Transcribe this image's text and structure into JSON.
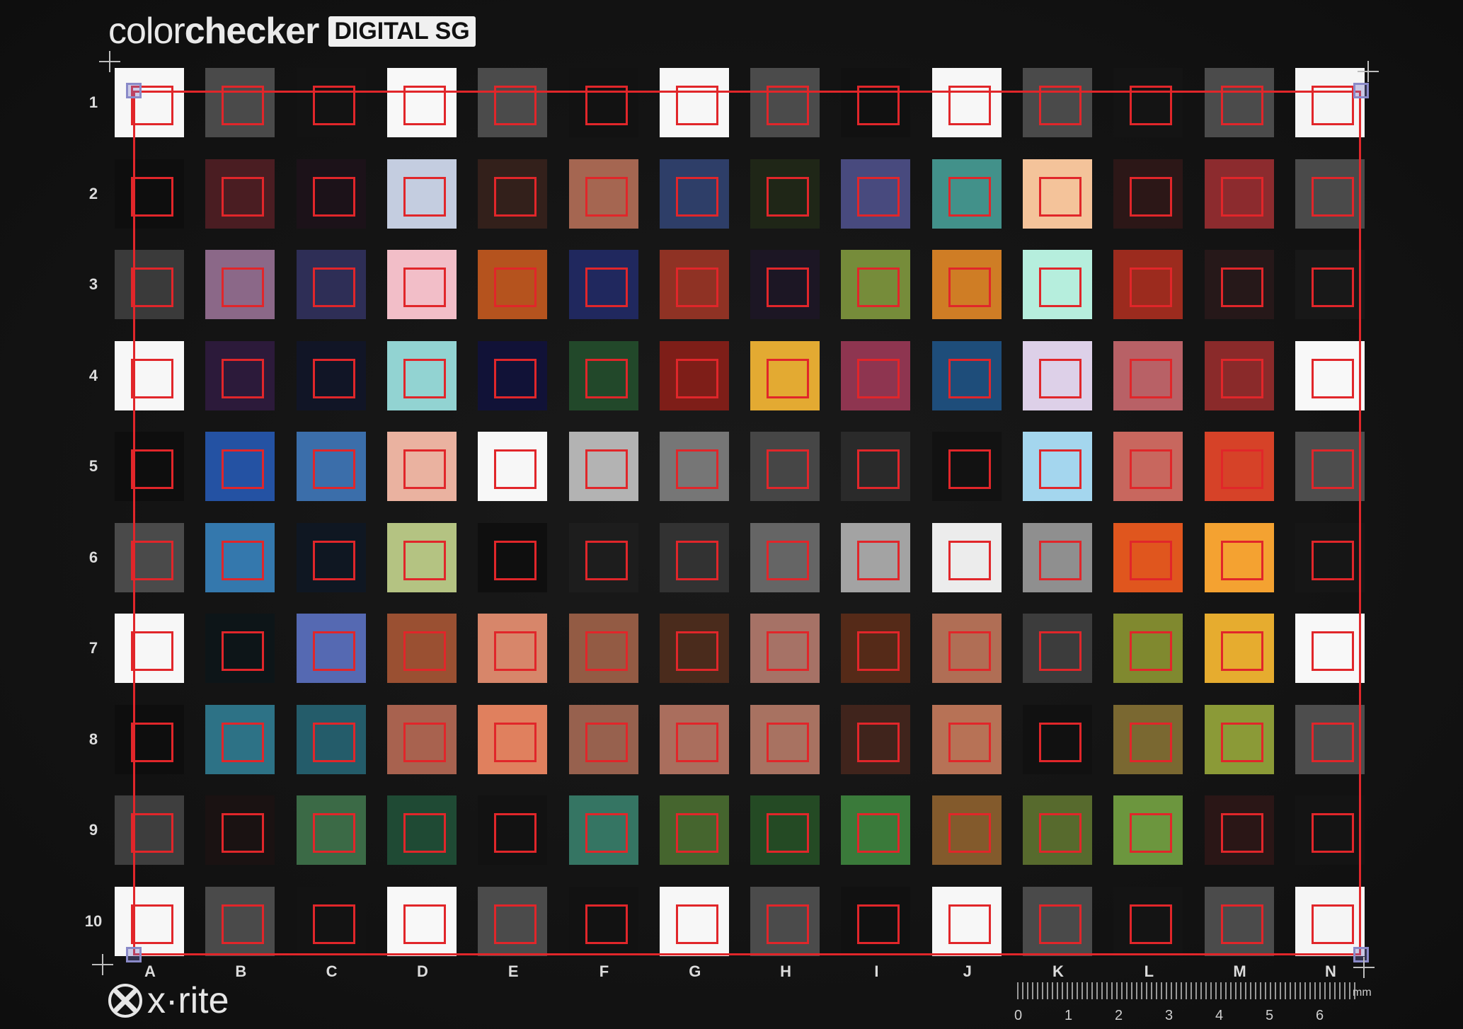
{
  "logo": {
    "light": "color",
    "bold": "checker",
    "badge": "DIGITAL SG"
  },
  "brand": {
    "name": "x·rite",
    "icon": "xrite-logo-icon"
  },
  "columns": [
    "A",
    "B",
    "C",
    "D",
    "E",
    "F",
    "G",
    "H",
    "I",
    "J",
    "K",
    "L",
    "M",
    "N"
  ],
  "rows": [
    "1",
    "2",
    "3",
    "4",
    "5",
    "6",
    "7",
    "8",
    "9",
    "10"
  ],
  "ruler": {
    "numbers": [
      "0",
      "1",
      "2",
      "3",
      "4",
      "5",
      "6"
    ],
    "unit": "mm"
  },
  "colors": {
    "marker": "#e1262a",
    "background": "#141414"
  },
  "patches": [
    [
      "#f7f7f7",
      "#4a4a4a",
      "#131313",
      "#f8f8f8",
      "#4b4b4b",
      "#121212",
      "#f7f7f7",
      "#4b4b4b",
      "#111111",
      "#f7f7f7",
      "#4a4a4a",
      "#141414",
      "#4b4b4b",
      "#f5f5f5"
    ],
    [
      "#0e0e0e",
      "#4a1d22",
      "#1c1219",
      "#c4cde0",
      "#33201b",
      "#a56651",
      "#2e3e68",
      "#1f2617",
      "#484a7e",
      "#42918a",
      "#f4c39a",
      "#2c1717",
      "#8c2b2e",
      "#4a4a4a"
    ],
    [
      "#3a3a3a",
      "#8b6888",
      "#2e2e56",
      "#f2bec8",
      "#b5531e",
      "#20285e",
      "#8f3224",
      "#1c1624",
      "#768c3a",
      "#cf7d25",
      "#b6eedd",
      "#9c2b1e",
      "#261819",
      "#181818"
    ],
    [
      "#f7f7f7",
      "#2c1a3a",
      "#111526",
      "#92d3d2",
      "#111237",
      "#22482a",
      "#7e1e18",
      "#e3aa32",
      "#8e3550",
      "#1e4d7a",
      "#ddd0e8",
      "#b86166",
      "#8a2a2a",
      "#f8f8f8"
    ],
    [
      "#0e0e0e",
      "#2452a3",
      "#3b6eaa",
      "#eab2a0",
      "#f7f7f7",
      "#b3b3b3",
      "#767676",
      "#464646",
      "#2a2a2a",
      "#121212",
      "#a4d6ee",
      "#c8675e",
      "#d64228",
      "#4d4d4d"
    ],
    [
      "#4a4a4a",
      "#3478ad",
      "#0f1722",
      "#b4c382",
      "#0f0f0f",
      "#1d1d1d",
      "#323232",
      "#656565",
      "#a3a3a3",
      "#ececec",
      "#8f8f8f",
      "#e0561e",
      "#f4a231",
      "#161616"
    ],
    [
      "#f7f7f7",
      "#0d1518",
      "#5569b2",
      "#9a5032",
      "#d7866a",
      "#935b44",
      "#4a2b1c",
      "#a67266",
      "#552a18",
      "#b06e55",
      "#3c3c3c",
      "#80892f",
      "#e6ac2f",
      "#f8f8f8"
    ],
    [
      "#0e0e0e",
      "#2d7286",
      "#245c6a",
      "#a8624f",
      "#e0805e",
      "#97614e",
      "#aa6e5d",
      "#a87261",
      "#40241c",
      "#b77256",
      "#111111",
      "#7a6831",
      "#8b9a37",
      "#4d4d4d"
    ],
    [
      "#3e3e3e",
      "#1a1212",
      "#3b6a46",
      "#1f4a34",
      "#121212",
      "#357563",
      "#45652e",
      "#244a24",
      "#3a7a3a",
      "#835a2c",
      "#576a2d",
      "#6c963e",
      "#2a1616",
      "#141414"
    ],
    [
      "#f7f7f7",
      "#4a4a4a",
      "#131313",
      "#f8f8f8",
      "#4b4b4b",
      "#121212",
      "#f7f7f7",
      "#4b4b4b",
      "#111111",
      "#f7f7f7",
      "#4a4a4a",
      "#141414",
      "#4b4b4b",
      "#f5f5f5"
    ]
  ]
}
